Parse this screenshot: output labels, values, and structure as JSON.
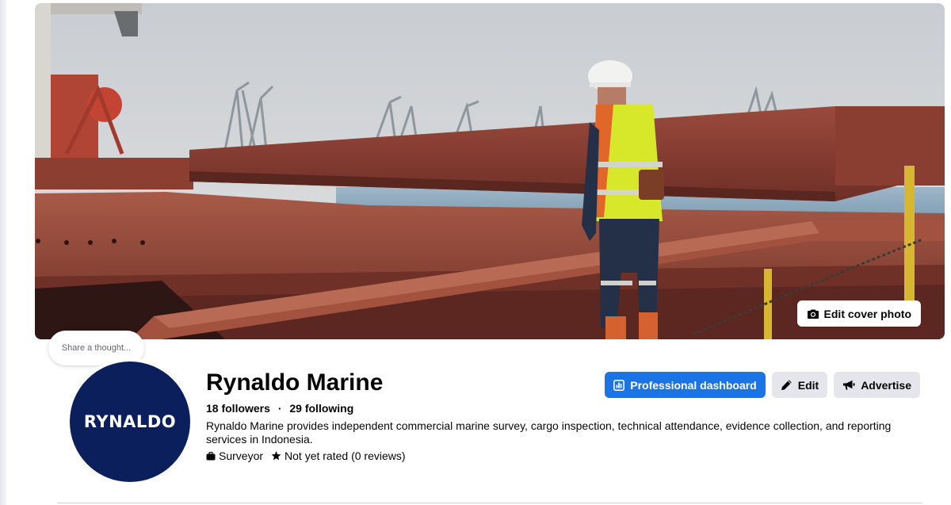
{
  "cover": {
    "edit_label": "Edit cover photo",
    "edit_icon": "camera-icon"
  },
  "thought": {
    "placeholder": "Share a thought..."
  },
  "avatar": {
    "logo_text": "RYNALDO",
    "background": "#0b1f5c"
  },
  "profile": {
    "name": "Rynaldo Marine",
    "followers": "18 followers",
    "separator": "·",
    "following": "29 following",
    "bio": "Rynaldo Marine provides independent commercial marine survey, cargo inspection, technical attendance, evidence collection, and reporting services in Indonesia.",
    "category": "Surveyor",
    "category_icon": "briefcase-icon",
    "rating": "Not yet rated (0 reviews)",
    "rating_icon": "star-icon"
  },
  "actions": {
    "dashboard_label": "Professional dashboard",
    "dashboard_icon": "chart-icon",
    "edit_label": "Edit",
    "edit_icon": "pencil-icon",
    "advertise_label": "Advertise",
    "advertise_icon": "megaphone-icon"
  },
  "colors": {
    "primary": "#1b74e4",
    "secondary_button": "#e4e6eb",
    "text": "#050505"
  }
}
